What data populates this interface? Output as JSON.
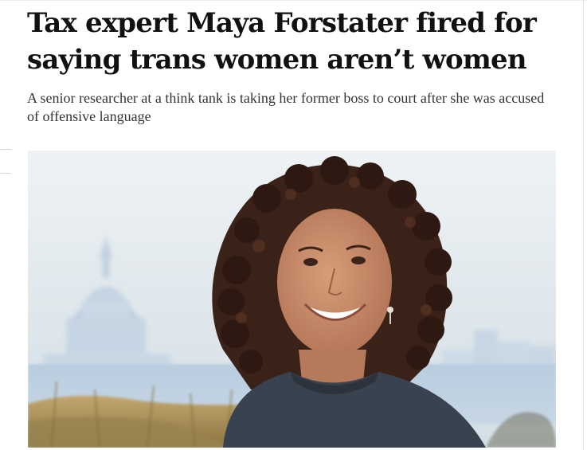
{
  "article": {
    "headline": "Tax expert Maya Forstater fired for saying trans women aren’t women",
    "standfirst": "A senior researcher at a think tank is taking her former boss to court after she was accused of offensive language"
  },
  "photo": {
    "icon": "portrait-photo",
    "colors": {
      "sky": "#dde7ee",
      "water": "#b7cde2",
      "hair": "#3a2218",
      "skin": "#c88d6b",
      "top": "#39424f"
    }
  }
}
